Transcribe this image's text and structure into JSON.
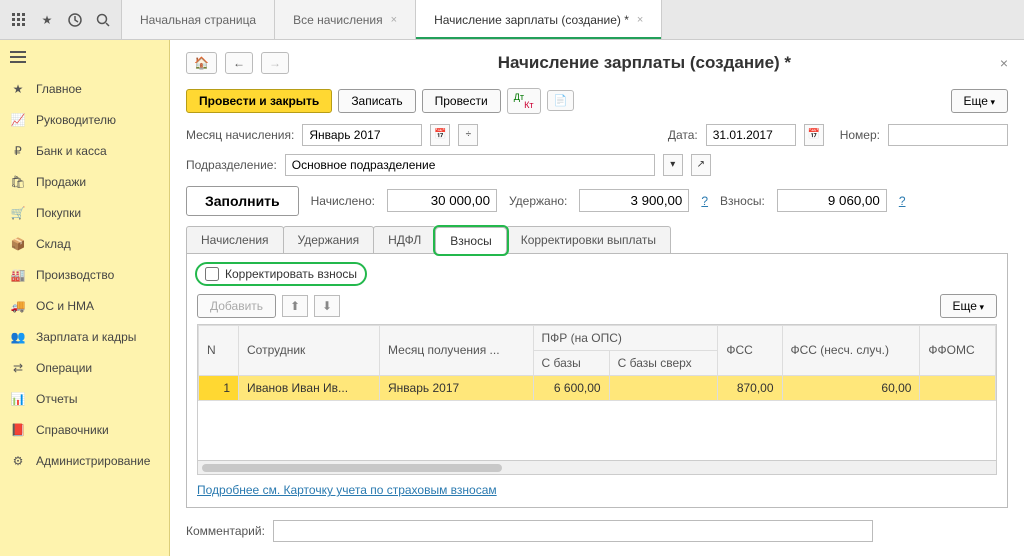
{
  "top_tabs": {
    "t0": "Начальная страница",
    "t1": "Все начисления",
    "t2": "Начисление зарплаты (создание) *"
  },
  "sidebar": {
    "items": [
      "Главное",
      "Руководителю",
      "Банк и касса",
      "Продажи",
      "Покупки",
      "Склад",
      "Производство",
      "ОС и НМА",
      "Зарплата и кадры",
      "Операции",
      "Отчеты",
      "Справочники",
      "Администрирование"
    ]
  },
  "page": {
    "title": "Начисление зарплаты (создание) *",
    "toolbar": {
      "post_close": "Провести и закрыть",
      "write": "Записать",
      "post": "Провести",
      "more": "Еще"
    },
    "form": {
      "month_label": "Месяц начисления:",
      "month_value": "Январь 2017",
      "date_label": "Дата:",
      "date_value": "31.01.2017",
      "number_label": "Номер:",
      "dept_label": "Подразделение:",
      "dept_value": "Основное подразделение",
      "fill_btn": "Заполнить",
      "accrued_label": "Начислено:",
      "accrued_value": "30 000,00",
      "withheld_label": "Удержано:",
      "withheld_value": "3 900,00",
      "contrib_label": "Взносы:",
      "contrib_value": "9 060,00",
      "q": "?"
    },
    "inner_tabs": {
      "t0": "Начисления",
      "t1": "Удержания",
      "t2": "НДФЛ",
      "t3": "Взносы",
      "t4": "Корректировки выплаты"
    },
    "pane": {
      "correct_label": "Корректировать взносы",
      "add_btn": "Добавить",
      "more": "Еще",
      "headers": {
        "n": "N",
        "emp": "Сотрудник",
        "month": "Месяц получения ...",
        "pfr": "ПФР (на ОПС)",
        "pfr_base": "С базы",
        "pfr_over": "С базы сверх",
        "fss": "ФСС",
        "fss_acc": "ФСС (несч. случ.)",
        "ffoms": "ФФОМС"
      },
      "row1": {
        "n": "1",
        "emp": "Иванов Иван Ив...",
        "month": "Январь 2017",
        "pfr_base": "6 600,00",
        "pfr_over": "",
        "fss": "870,00",
        "fss_acc": "60,00",
        "ffoms": ""
      },
      "link": "Подробнее см. Карточку учета по страховым взносам"
    },
    "comment_label": "Комментарий:"
  }
}
